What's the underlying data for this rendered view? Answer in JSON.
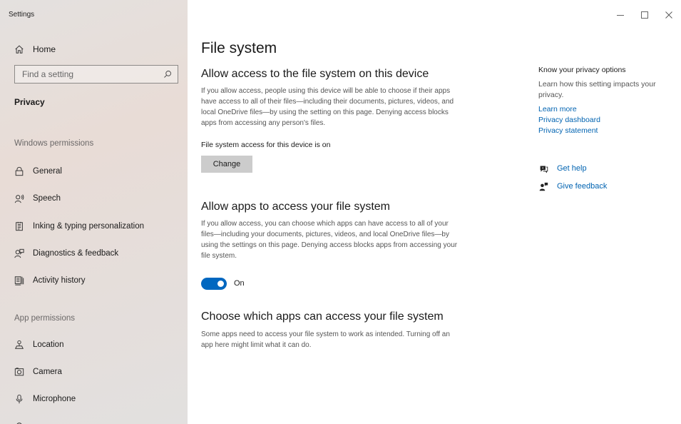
{
  "window": {
    "title": "Settings"
  },
  "sidebar": {
    "home_label": "Home",
    "search_placeholder": "Find a setting",
    "section_title": "Privacy",
    "group_windows": "Windows permissions",
    "windows_items": [
      {
        "label": "General",
        "icon": "lock-icon"
      },
      {
        "label": "Speech",
        "icon": "speech-icon"
      },
      {
        "label": "Inking & typing personalization",
        "icon": "inking-icon"
      },
      {
        "label": "Diagnostics & feedback",
        "icon": "diagnostics-icon"
      },
      {
        "label": "Activity history",
        "icon": "activity-history-icon"
      }
    ],
    "group_app": "App permissions",
    "app_items": [
      {
        "label": "Location",
        "icon": "location-icon"
      },
      {
        "label": "Camera",
        "icon": "camera-icon"
      },
      {
        "label": "Microphone",
        "icon": "microphone-icon"
      }
    ]
  },
  "main": {
    "page_title": "File system",
    "section1": {
      "heading": "Allow access to the file system on this device",
      "description": "If you allow access, people using this device will be able to choose if their apps have access to all of their files—including their documents, pictures, videos, and local OneDrive files—by using the setting on this page. Denying access blocks apps from accessing any person's files.",
      "status": "File system access for this device is on",
      "change_button": "Change"
    },
    "section2": {
      "heading": "Allow apps to access your file system",
      "description": "If you allow access, you can choose which apps can have access to all of your files—including your documents, pictures, videos, and local OneDrive files—by using the settings on this page. Denying access blocks apps from accessing your file system.",
      "toggle_state": "On",
      "toggle_on": true
    },
    "section3": {
      "heading": "Choose which apps can access your file system",
      "description": "Some apps need to access your file system to work as intended. Turning off an app here might limit what it can do."
    }
  },
  "right_panel": {
    "heading": "Know your privacy options",
    "description": "Learn how this setting impacts your privacy.",
    "links": [
      "Learn more",
      "Privacy dashboard",
      "Privacy statement"
    ],
    "get_help": "Get help",
    "give_feedback": "Give feedback"
  },
  "colors": {
    "accent": "#0067c0",
    "link": "#0063b1",
    "button_bg": "#cccccc"
  }
}
